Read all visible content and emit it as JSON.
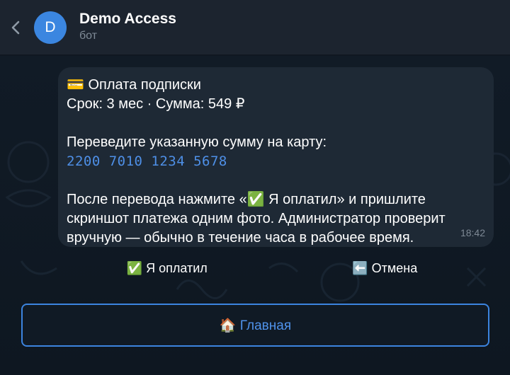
{
  "header": {
    "avatar_letter": "D",
    "title": "Demo Access",
    "subtitle": "бот",
    "back_icon": "chevron-left-icon"
  },
  "message": {
    "line1": "💳 Оплата подписки",
    "line2": "Срок: 3 мес · Сумма: 549 ₽",
    "line3": "Переведите указанную сумму на карту:",
    "card_number": "2200 7010 1234 5678",
    "line5": "После перевода нажмите «✅ Я оплатил» и пришлите",
    "line6": "скриншот платежа одним фото. Администратор проверит",
    "line7": "вручную — обычно в течение часа в рабочее время.",
    "time": "18:42"
  },
  "inline_buttons": {
    "paid_label": "✅ Я оплатил",
    "cancel_label": "⬅️ Отмена"
  },
  "keyboard": {
    "main_label": "🏠 Главная"
  },
  "colors": {
    "accent": "#3b86e0",
    "link": "#4e8fe6",
    "header_bg": "#1c242f",
    "bubble_bg": "#1e2935",
    "chat_bg": "#0f1822"
  }
}
